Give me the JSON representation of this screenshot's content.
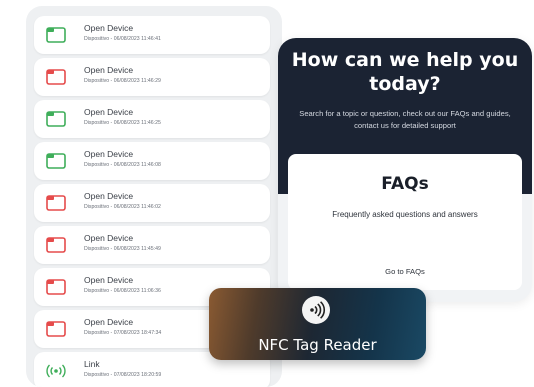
{
  "colors": {
    "icon_green": "#3fae5a",
    "icon_red": "#e54b4b",
    "panel_dark": "#1b2333"
  },
  "log": {
    "items": [
      {
        "title": "Open Device",
        "subtitle": "Dispositivo - 06/08/2023 11:46:41",
        "icon": "device-green-icon"
      },
      {
        "title": "Open Device",
        "subtitle": "Dispositivo - 06/08/2023 11:46:29",
        "icon": "device-red-icon"
      },
      {
        "title": "Open Device",
        "subtitle": "Dispositivo - 06/08/2023 11:46:25",
        "icon": "device-green-icon"
      },
      {
        "title": "Open Device",
        "subtitle": "Dispositivo - 06/08/2023 11:46:08",
        "icon": "device-green-icon"
      },
      {
        "title": "Open Device",
        "subtitle": "Dispositivo - 06/08/2023 11:46:02",
        "icon": "device-red-icon"
      },
      {
        "title": "Open Device",
        "subtitle": "Dispositivo - 06/08/2023 11:45:49",
        "icon": "device-red-icon"
      },
      {
        "title": "Open Device",
        "subtitle": "Dispositivo - 06/08/2023 11:06:36",
        "icon": "device-red-icon"
      },
      {
        "title": "Open Device",
        "subtitle": "Dispositivo - 07/08/2023 18:47:34",
        "icon": "device-red-icon"
      },
      {
        "title": "Link",
        "subtitle": "Dispositivo - 07/08/2023 18:20:59",
        "icon": "nfc-signal-icon"
      }
    ]
  },
  "help": {
    "heading_line1": "How can we help you",
    "heading_line2": "today?",
    "description": "Search for a topic or question, check out our FAQs and guides, contact us for detailed support",
    "faq_title": "FAQs",
    "faq_desc": "Frequently asked questions and answers",
    "faq_link": "Go to FAQs"
  },
  "nfc": {
    "label": "NFC Tag Reader",
    "icon": "nfc-icon"
  }
}
